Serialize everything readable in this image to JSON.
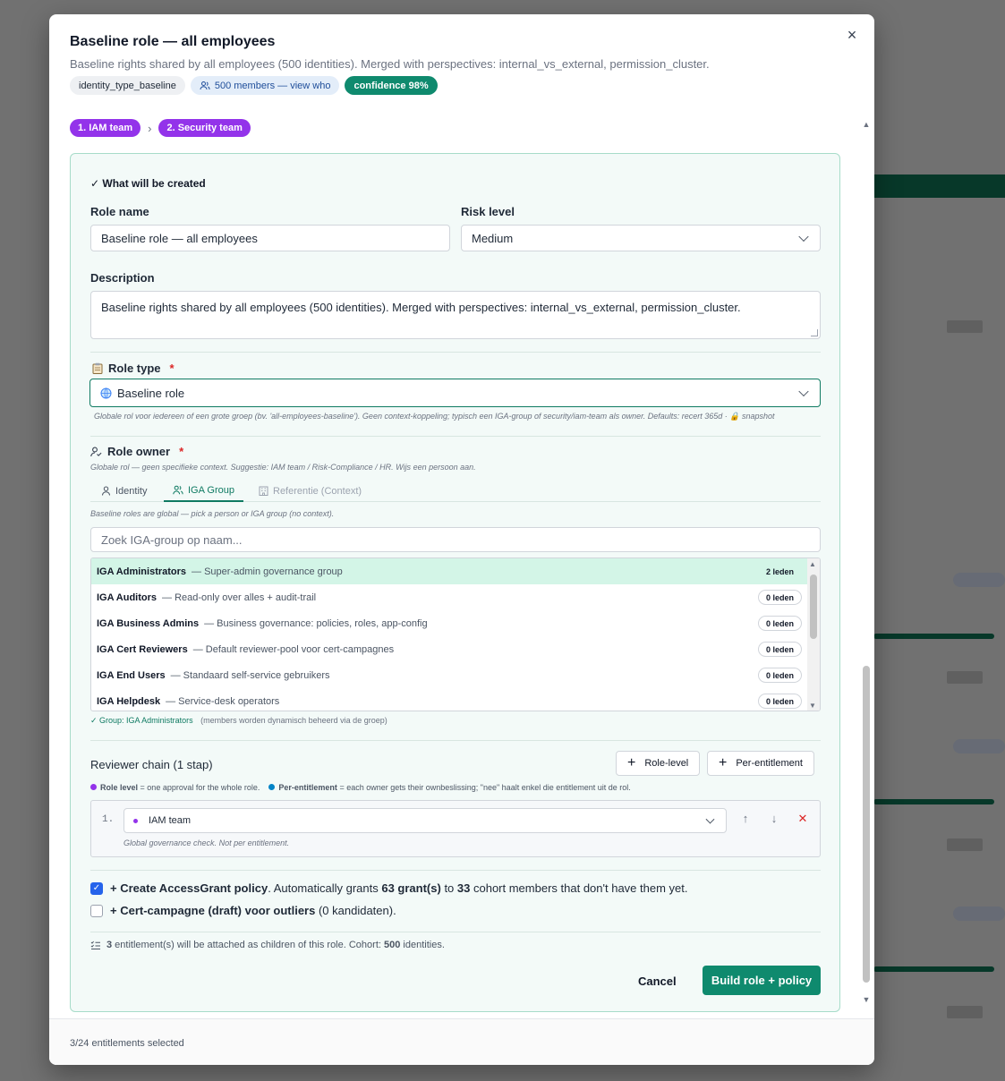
{
  "modal": {
    "title": "Baseline role — all employees",
    "subtitle": "Baseline rights shared by all employees (500 identities). Merged with perspectives: internal_vs_external, permission_cluster.",
    "chips": {
      "type": "identity_type_baseline",
      "members": "500 members — view who",
      "confidence": "confidence 98%"
    },
    "close_icon": "×"
  },
  "steps": [
    "1. IAM team",
    "2. Security team"
  ],
  "form": {
    "section_title": "✓ What will be created",
    "role_name_label": "Role name",
    "role_name_value": "Baseline role — all employees",
    "risk_label": "Risk level",
    "risk_value": "Medium",
    "description_label": "Description",
    "description_value": "Baseline rights shared by all employees (500 identities). Merged with perspectives: internal_vs_external, permission_cluster.",
    "role_type_label": "Role type",
    "role_type_value": "Baseline role",
    "role_type_hint": "Globale rol voor iedereen of een grote groep (bv. 'all-employees-baseline'). Geen context-koppeling; typisch een IGA-group of security/iam-team als owner. Defaults: recert 365d · 🔒 snapshot",
    "owner_label": "Role owner",
    "owner_hint": "Globale rol — geen specifieke context. Suggestie: IAM team / Risk-Compliance / HR. Wijs een persoon aan.",
    "owner_tabs": [
      "Identity",
      "IGA Group",
      "Referentie (Context)"
    ],
    "owner_tab_hint": "Baseline roles are global — pick a person or IGA group (no context).",
    "search_placeholder": "Zoek IGA-group op naam...",
    "groups": [
      {
        "name": "IGA Administrators",
        "desc": "— Super-admin governance group",
        "count": "2 leden"
      },
      {
        "name": "IGA Auditors",
        "desc": "— Read-only over alles + audit-trail",
        "count": "0 leden"
      },
      {
        "name": "IGA Business Admins",
        "desc": "— Business governance: policies, roles, app-config",
        "count": "0 leden"
      },
      {
        "name": "IGA Cert Reviewers",
        "desc": "— Default reviewer-pool voor cert-campagnes",
        "count": "0 leden"
      },
      {
        "name": "IGA End Users",
        "desc": "— Standaard self-service gebruikers",
        "count": "0 leden"
      },
      {
        "name": "IGA Helpdesk",
        "desc": "— Service-desk operators",
        "count": "0 leden"
      }
    ],
    "group_selected": "✓ Group: IGA Administrators",
    "group_selected_note": "(members worden dynamisch beheerd via de groep)",
    "reviewer_title": "Reviewer chain (1 stap)",
    "btn_role_level": "Role-level",
    "btn_per_entitlement": "Per-entitlement",
    "legend_role_level_key": "Role level",
    "legend_role_level_text": "= one approval for the whole role.",
    "legend_per_ent_key": "Per-entitlement",
    "legend_per_ent_text": "= each owner gets their ownbeslissing; \"nee\" haalt enkel die entitlement uit de rol.",
    "chain_num": "1.",
    "chain_value": "IAM team",
    "chain_hint": "Global governance check. Not per entitlement.",
    "policy_check": {
      "prefix": "+ Create AccessGrant policy",
      "t1": ". Automatically grants ",
      "grants": "63 grant(s)",
      "t2": " to ",
      "members": "33",
      "t3": " cohort members that don't have them yet."
    },
    "cert_check": {
      "prefix": "+ Cert-campagne (draft) voor outliers",
      "suffix": " (0 kandidaten)."
    },
    "summary": {
      "count": "3",
      "t1": " entitlement(s) will be attached as children of this role. Cohort: ",
      "cohort": "500",
      "t2": " identities."
    },
    "cancel": "Cancel",
    "submit": "Build role + policy"
  },
  "footer_text": "3/24 entitlements selected",
  "colors": {
    "accent": "#0f8a6e",
    "step": "#9333ea",
    "selected_row": "#d3f5e7",
    "checkbox": "#2563eb"
  },
  "icons": {
    "members": "people-icon",
    "role_type": "clipboard-icon",
    "globe": "globe-icon",
    "owner": "user-check-icon",
    "checklist": "checklist-icon"
  }
}
